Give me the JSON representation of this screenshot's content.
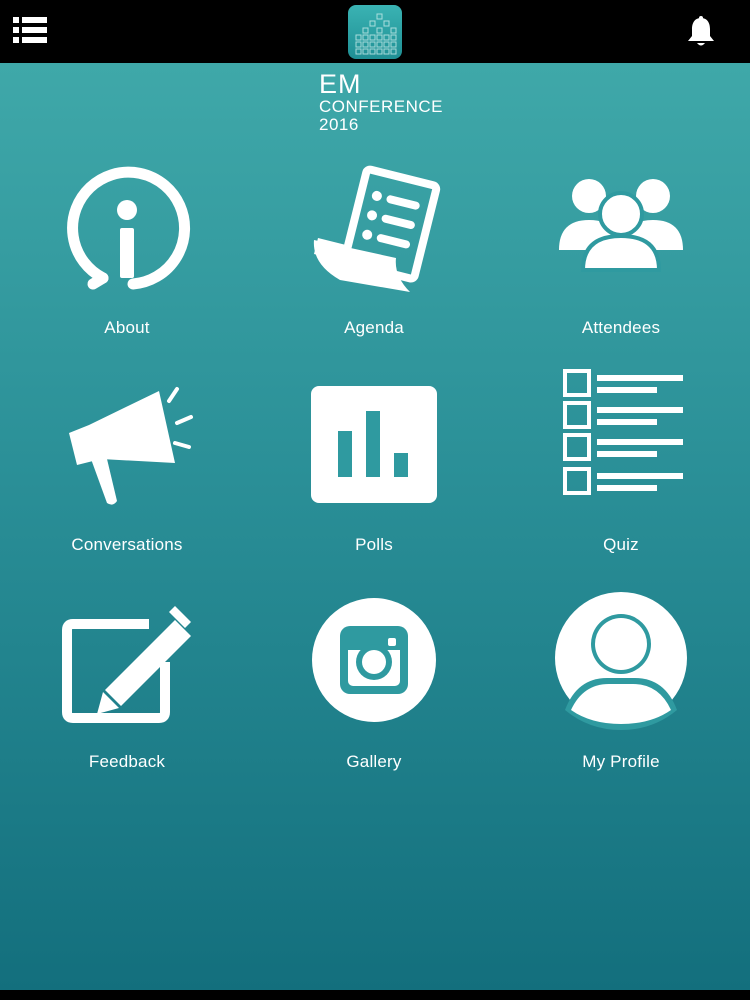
{
  "header": {
    "menu_icon": "list-menu-icon",
    "logo_icon": "app-logo-icon",
    "notification_icon": "bell-icon"
  },
  "brand": {
    "line1": "EM",
    "line2": "CONFERENCE",
    "line3": "2016"
  },
  "colors": {
    "background_top": "#3fa8a9",
    "background_bottom": "#136f7d",
    "bar": "#000000",
    "foreground": "#ffffff"
  },
  "tiles": [
    {
      "label": "About",
      "icon": "info-icon"
    },
    {
      "label": "Agenda",
      "icon": "document-list-icon"
    },
    {
      "label": "Attendees",
      "icon": "users-group-icon"
    },
    {
      "label": "Conversations",
      "icon": "megaphone-icon"
    },
    {
      "label": "Polls",
      "icon": "bar-chart-icon"
    },
    {
      "label": "Quiz",
      "icon": "checklist-icon"
    },
    {
      "label": "Feedback",
      "icon": "edit-square-icon"
    },
    {
      "label": "Gallery",
      "icon": "instagram-camera-icon"
    },
    {
      "label": "My Profile",
      "icon": "user-avatar-icon"
    }
  ]
}
